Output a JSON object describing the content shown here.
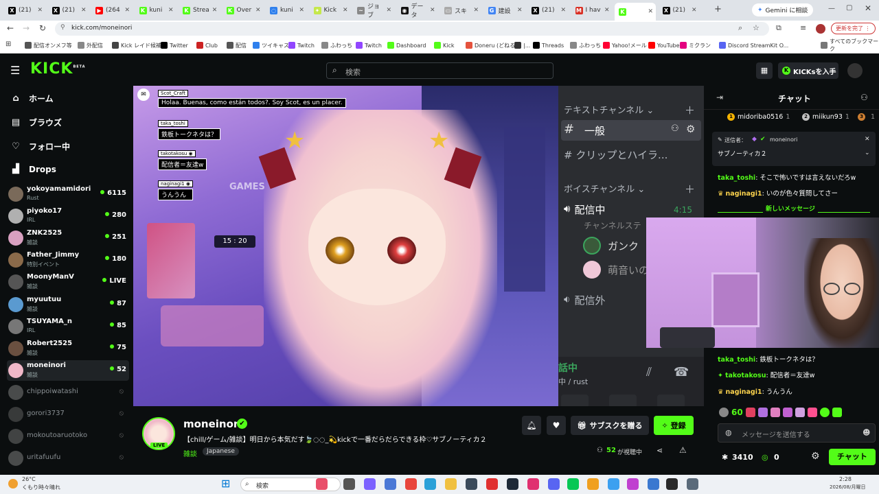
{
  "browser": {
    "tabs": [
      {
        "label": "(21)",
        "color": "#000000",
        "glyph": "X"
      },
      {
        "label": "(21)",
        "color": "#000000",
        "glyph": "X"
      },
      {
        "label": "(264",
        "color": "#ff0000",
        "glyph": "▶"
      },
      {
        "label": "kuni",
        "color": "#53fc18",
        "glyph": "K"
      },
      {
        "label": "Strea",
        "color": "#53fc18",
        "glyph": "K"
      },
      {
        "label": "Over",
        "color": "#53fc18",
        "glyph": "K"
      },
      {
        "label": "kuni",
        "color": "#2f80ed",
        "glyph": "◌"
      },
      {
        "label": "Kick",
        "color": "#c5e84b",
        "glyph": "✦"
      },
      {
        "label": "ジョブ",
        "color": "#888888",
        "glyph": "~"
      },
      {
        "label": "データ",
        "color": "#111111",
        "glyph": "◉"
      },
      {
        "label": "スキ",
        "color": "#aaaaaa",
        "glyph": "▭"
      },
      {
        "label": "建設",
        "color": "#4285f4",
        "glyph": "G"
      },
      {
        "label": "(21)",
        "color": "#000000",
        "glyph": "X"
      },
      {
        "label": "I hav",
        "color": "#d93025",
        "glyph": "M"
      },
      {
        "label": "",
        "color": "#53fc18",
        "glyph": "K"
      },
      {
        "label": "(21)",
        "color": "#000000",
        "glyph": "X"
      }
    ],
    "new_tab": "+",
    "gemini_button": "Gemini に相談",
    "url": "kick.com/moneinori",
    "profile_button": "更新を完了 ⋮",
    "bookmarks": [
      {
        "label": "配信オンメフ等",
        "color": "#555555"
      },
      {
        "label": "外配信",
        "color": "#888888"
      },
      {
        "label": "Kick レイド候補",
        "color": "#444444"
      },
      {
        "label": "Twitter",
        "color": "#000000"
      },
      {
        "label": "Club",
        "color": "#cc2222"
      },
      {
        "label": "配信",
        "color": "#555555"
      },
      {
        "label": "ツイキャス",
        "color": "#2f80ed"
      },
      {
        "label": "Twitch",
        "color": "#9146ff"
      },
      {
        "label": "ふわっち",
        "color": "#888888"
      },
      {
        "label": "Twitch",
        "color": "#9146ff"
      },
      {
        "label": "Dashboard",
        "color": "#53fc18"
      },
      {
        "label": "Kick",
        "color": "#53fc18"
      },
      {
        "label": "Doneru (どねる)",
        "color": "#e5533d"
      },
      {
        "label": "|...",
        "color": "#333333"
      },
      {
        "label": "Threads",
        "color": "#000000"
      },
      {
        "label": "ふわっち",
        "color": "#888888"
      },
      {
        "label": "Yahoo!メール",
        "color": "#ff0033"
      },
      {
        "label": "YouTube",
        "color": "#ff0000"
      },
      {
        "label": "ミクラン",
        "color": "#e4007f"
      },
      {
        "label": "Discord StreamKit O...",
        "color": "#5865f2"
      }
    ],
    "all_bookmarks": "すべてのブックマーク"
  },
  "kick": {
    "logo": "KICK",
    "logo_sup": "BETA",
    "search_placeholder": "検索",
    "get_kicks": "KICKsを入手",
    "nav": [
      {
        "icon": "⌂",
        "label": "ホーム"
      },
      {
        "icon": "▤",
        "label": "ブラウズ"
      },
      {
        "icon": "♡",
        "label": "フォロー中"
      },
      {
        "icon": "▟",
        "label": "Drops"
      }
    ],
    "channels": [
      {
        "name": "yokoyamamidori",
        "category": "Rust",
        "viewers": "6115",
        "live": true,
        "color": "#7a6a5a"
      },
      {
        "name": "piyoko17",
        "category": "IRL",
        "viewers": "280",
        "live": true,
        "color": "#b0b0b0"
      },
      {
        "name": "ZNK2525",
        "category": "雑談",
        "viewers": "251",
        "live": true,
        "color": "#d8a0c0"
      },
      {
        "name": "Father_Jimmy",
        "category": "特別イベント",
        "viewers": "180",
        "live": true,
        "color": "#8a6a4a"
      },
      {
        "name": "MoonyManV",
        "category": "雑談",
        "viewers": "LIVE",
        "live": true,
        "color": "#555555"
      },
      {
        "name": "myuutuu",
        "category": "雑談",
        "viewers": "87",
        "live": true,
        "color": "#5a9ad0"
      },
      {
        "name": "TSUYAMA_n",
        "category": "IRL",
        "viewers": "85",
        "live": true,
        "color": "#777777"
      },
      {
        "name": "Robert2525",
        "category": "雑談",
        "viewers": "75",
        "live": true,
        "color": "#6a5040"
      },
      {
        "name": "moneinori",
        "category": "雑談",
        "viewers": "52",
        "live": true,
        "color": "#f0b8c8"
      },
      {
        "name": "chippoiwatashi",
        "category": "",
        "viewers": "",
        "live": false,
        "color": "#888888"
      },
      {
        "name": "gorori3737",
        "category": "",
        "viewers": "",
        "live": false,
        "color": "#666666"
      },
      {
        "name": "mokoutoaruotoko",
        "category": "",
        "viewers": "",
        "live": false,
        "color": "#777777"
      },
      {
        "name": "uritafuufu",
        "category": "",
        "viewers": "",
        "live": false,
        "color": "#888888"
      }
    ]
  },
  "video_overlay": {
    "chat": [
      {
        "user": "Scot_Craft",
        "msg": "Holaa. Buenas, como están todos?. Soy Scot, es un placer."
      },
      {
        "user": "taka_toshi",
        "msg": "鉄板トークネタは？"
      },
      {
        "user": "takotakosu ◉",
        "msg": "配信者＝友達w"
      },
      {
        "user": "naginagi1 ◉",
        "msg": "うんうん"
      }
    ],
    "clock": "15 : 20",
    "room_sign": "GAMES"
  },
  "discord": {
    "text_channels_label": "テキストチャンネル",
    "channel_general": "一般",
    "channel_clips": "クリップとハイラ...",
    "voice_channels_label": "ボイスチャンネル",
    "voice_live": "配信中",
    "voice_live_time": "4:15",
    "voice_live_sub": "チャンネルステ",
    "member1": "ガンク",
    "member2": "萌音いの",
    "voice_off": "配信外",
    "status_line1": "話中",
    "status_line2": "中 / rust"
  },
  "chat": {
    "title": "チャット",
    "leaderboard": [
      {
        "rank": "1",
        "name": "midoriba0516",
        "count": "1",
        "color": "#f5b301"
      },
      {
        "rank": "2",
        "name": "miikun93",
        "count": "1",
        "color": "#c0c0c0"
      },
      {
        "rank": "3",
        "name": "",
        "count": "1",
        "color": "#cd7f32"
      }
    ],
    "pinned_label": "送信者：",
    "pinned_user": "moneinori",
    "pinned_text": "サブノーティカ２",
    "messages_top": [
      {
        "user": "taka_toshi",
        "text": ": そこで怖いですは言えないだろw",
        "gold": false
      },
      {
        "user": "naginagi1",
        "text": ": いのが色々質問してさー",
        "gold": true
      }
    ],
    "new_messages": "新しいメッセージ",
    "messages_bottom": [
      {
        "user": "taka_toshi",
        "text": ": 鉄板トークネタは？",
        "gold": false
      },
      {
        "user": "takotakosu",
        "text": ": 配信者＝友達w",
        "gold": false
      },
      {
        "user": "naginagi1",
        "text": ": うんうん",
        "gold": true
      }
    ],
    "emote_count": "60",
    "input_placeholder": "メッセージを送信する",
    "kicks_count": "3410",
    "points": "0",
    "send_button": "チャット"
  },
  "stream": {
    "streamer": "moneinori",
    "live_badge": "LIVE",
    "title": "【chill/ゲーム/雑談】明日から本気だす🍃◌◌_💫kickで一番だらだらできる枠♡サブノーティカ２",
    "tags": [
      "雑談",
      "Japanese"
    ],
    "subscribe_gift": "サブスクを贈る",
    "follow": "登録",
    "viewers": "52",
    "viewers_suffix": "が視聴中"
  },
  "taskbar": {
    "weather_temp": "26°C",
    "weather_text": "くもり時々晴れ",
    "search": "検索",
    "time": "2:28",
    "date": "2026/08/月曜日"
  },
  "colors": {
    "kick_green": "#53fc18",
    "bg_dark": "#0b0e0f",
    "discord_bg": "#2b2d31"
  }
}
